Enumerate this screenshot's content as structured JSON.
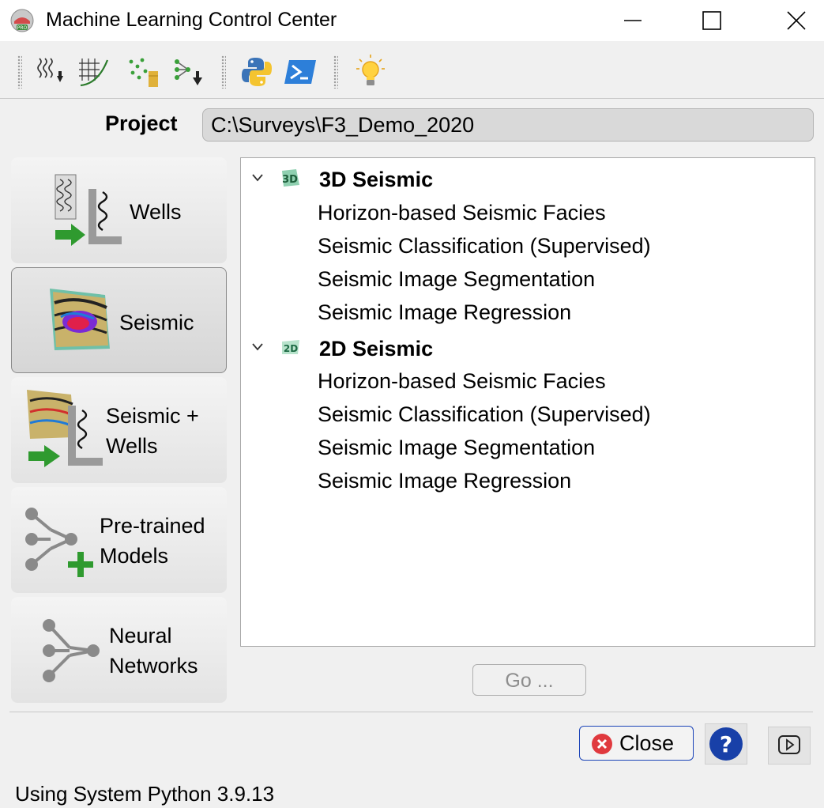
{
  "window": {
    "title": "Machine Learning Control Center",
    "app_icon": "opendtect-pro-icon"
  },
  "toolbar": {
    "groups": [
      [
        "log-import-icon",
        "crossplot-icon",
        "scatter-export-icon",
        "network-export-icon"
      ],
      [
        "python-icon",
        "powershell-icon"
      ],
      [
        "lightbulb-icon"
      ]
    ]
  },
  "project": {
    "label": "Project",
    "path": "C:\\Surveys\\F3_Demo_2020"
  },
  "categories": [
    {
      "label": "Wells",
      "selected": false
    },
    {
      "label": "Seismic",
      "selected": true
    },
    {
      "label": "Seismic + Wells",
      "line1": "Seismic +",
      "line2": "Wells",
      "selected": false
    },
    {
      "label": "Pre-trained Models",
      "line1": "Pre-trained",
      "line2": "Models",
      "selected": false
    },
    {
      "label": "Neural Networks",
      "line1": "Neural",
      "line2": "Networks",
      "selected": false
    }
  ],
  "tree": {
    "groups": [
      {
        "title": "3D Seismic",
        "badge": "3D",
        "expanded": true,
        "items": [
          "Horizon-based Seismic Facies",
          "Seismic Classification (Supervised)",
          "Seismic Image Segmentation",
          "Seismic Image Regression"
        ]
      },
      {
        "title": "2D Seismic",
        "badge": "2D",
        "expanded": true,
        "items": [
          "Horizon-based Seismic Facies",
          "Seismic Classification (Supervised)",
          "Seismic Image Segmentation",
          "Seismic Image Regression"
        ]
      }
    ]
  },
  "go_button": {
    "label": "Go ...",
    "enabled": false
  },
  "close_button": {
    "label": "Close"
  },
  "help_button": {
    "label": "?"
  },
  "status": "Using System Python 3.9.13",
  "colors": {
    "accent_blue": "#1b44b8",
    "close_red": "#e0393e",
    "arrow_green": "#2f9a2f",
    "disabled_text": "#8d8d8d"
  }
}
